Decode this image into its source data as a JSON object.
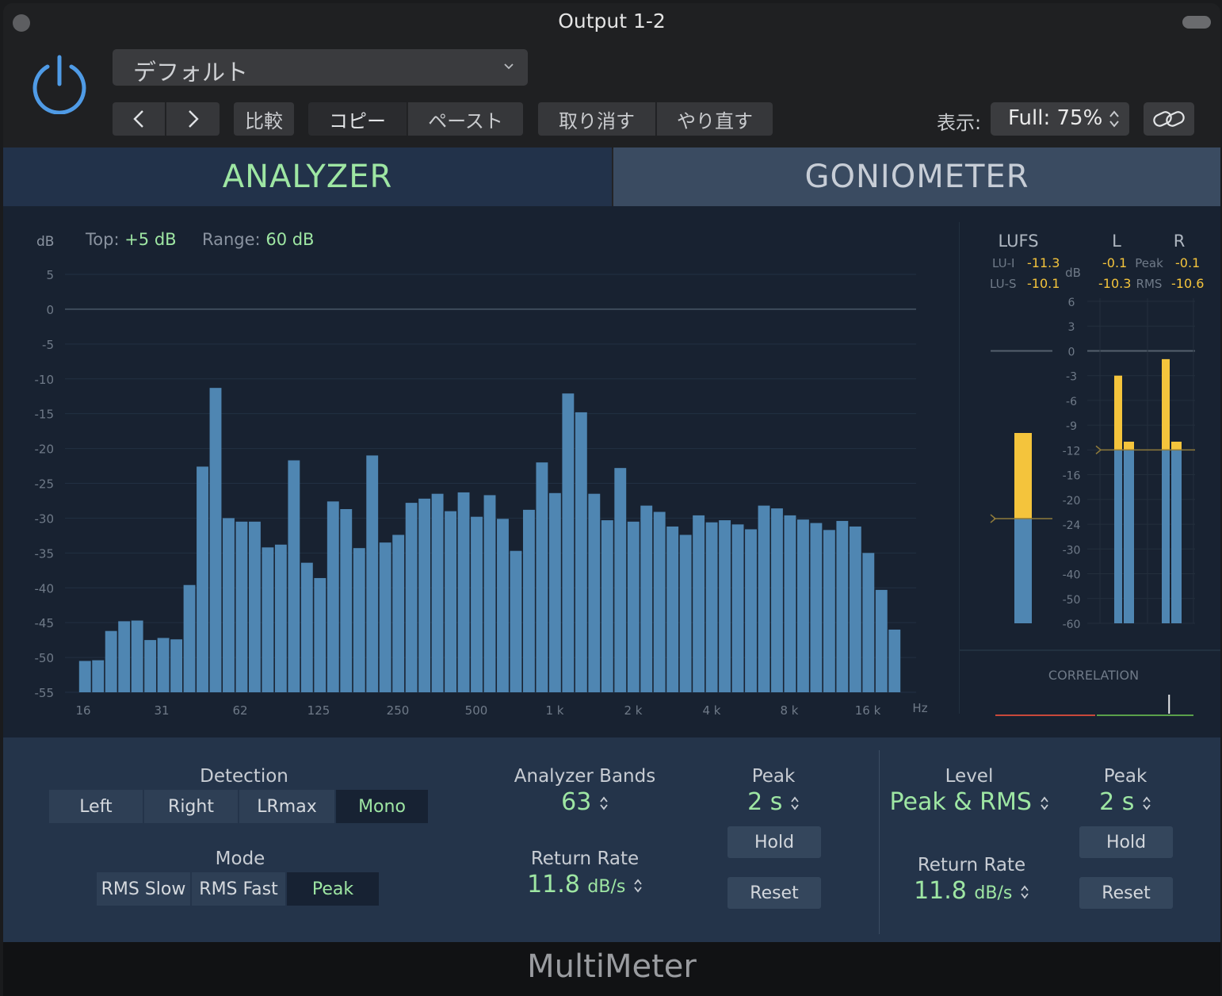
{
  "window": {
    "title": "Output 1-2"
  },
  "header": {
    "preset": "デフォルト",
    "compare": "比較",
    "copy": "コピー",
    "paste": "ペースト",
    "undo": "取り消す",
    "redo": "やり直す",
    "view_label": "表示:",
    "view_value": "Full: 75%"
  },
  "tabs": {
    "analyzer": "ANALYZER",
    "goniometer": "GONIOMETER"
  },
  "analyzer": {
    "unit": "dB",
    "top_label": "Top:",
    "top_value": "+5 dB",
    "range_label": "Range:",
    "range_value": "60 dB",
    "freq_unit": "Hz"
  },
  "chart_data": {
    "type": "bar",
    "ylabel": "dB",
    "xlabel": "Hz",
    "ylim": [
      -55,
      5
    ],
    "y_ticks": [
      5,
      0,
      -5,
      -10,
      -15,
      -20,
      -25,
      -30,
      -35,
      -40,
      -45,
      -50,
      -55
    ],
    "x_tick_labels": [
      "16",
      "31",
      "62",
      "125",
      "250",
      "500",
      "1 k",
      "2 k",
      "4 k",
      "8 k",
      "16 k"
    ],
    "values": [
      -50.5,
      -50.4,
      -46.2,
      -44.8,
      -44.7,
      -47.5,
      -47.2,
      -47.4,
      -39.6,
      -22.6,
      -11.3,
      -30.0,
      -30.5,
      -30.5,
      -34.2,
      -33.8,
      -21.7,
      -36.4,
      -38.6,
      -27.6,
      -28.7,
      -34.3,
      -21.0,
      -33.5,
      -32.4,
      -27.8,
      -27.2,
      -26.5,
      -29.0,
      -26.3,
      -29.8,
      -26.7,
      -30.1,
      -34.7,
      -28.8,
      -22.0,
      -26.4,
      -12.1,
      -14.8,
      -26.5,
      -30.3,
      -22.8,
      -30.5,
      -28.2,
      -29.1,
      -31.2,
      -32.4,
      -29.6,
      -30.6,
      -30.3,
      -30.9,
      -31.6,
      -28.2,
      -28.6,
      -29.6,
      -30.2,
      -30.7,
      -31.7,
      -30.4,
      -31.2,
      -35.0,
      -40.3,
      -46.0
    ]
  },
  "meters": {
    "lufs_label": "LUFS",
    "l_label": "L",
    "r_label": "R",
    "lui_label": "LU-I",
    "lui_value": "-11.3",
    "lus_label": "LU-S",
    "lus_value": "-10.1",
    "db_label": "dB",
    "peak_label": "Peak",
    "rms_label": "RMS",
    "l_peak": "-0.1",
    "r_peak": "-0.1",
    "l_rms": "-10.3",
    "r_rms": "-10.6",
    "scale": [
      "6",
      "3",
      "0",
      "-3",
      "-6",
      "-9",
      "-12",
      "-16",
      "-20",
      "-24",
      "-30",
      "-40",
      "-50",
      "-60"
    ],
    "lufs_level": -10.1,
    "lufs_target": -23,
    "l_peak_db": -3,
    "l_rms_db": -12,
    "l_hold_db": -11,
    "r_peak_db": -1,
    "r_rms_db": -12,
    "r_hold_db": -11,
    "rms_marker_db": -12,
    "correlation_label": "CORRELATION",
    "correlation_value": 0.75
  },
  "controls": {
    "detection_label": "Detection",
    "detection_options": [
      "Left",
      "Right",
      "LRmax",
      "Mono"
    ],
    "detection_selected": "Mono",
    "mode_label": "Mode",
    "mode_options": [
      "RMS Slow",
      "RMS Fast",
      "Peak"
    ],
    "mode_selected": "Peak",
    "bands_label": "Analyzer Bands",
    "bands_value": "63",
    "analyzer_peak_label": "Peak",
    "analyzer_peak_value": "2 s",
    "analyzer_hold": "Hold",
    "analyzer_return_label": "Return Rate",
    "analyzer_return_value": "11.8",
    "analyzer_return_unit": "dB/s",
    "analyzer_reset": "Reset",
    "level_label": "Level",
    "level_value": "Peak & RMS",
    "level_peak_label": "Peak",
    "level_peak_value": "2 s",
    "level_hold": "Hold",
    "level_return_label": "Return Rate",
    "level_return_value": "11.8",
    "level_return_unit": "dB/s",
    "level_reset": "Reset"
  },
  "footer": {
    "plugin_name": "MultiMeter"
  },
  "colors": {
    "accent": "#9ee6a3",
    "bar": "#4f86b2",
    "peak": "#f4c43c",
    "power": "#4f9be6"
  }
}
